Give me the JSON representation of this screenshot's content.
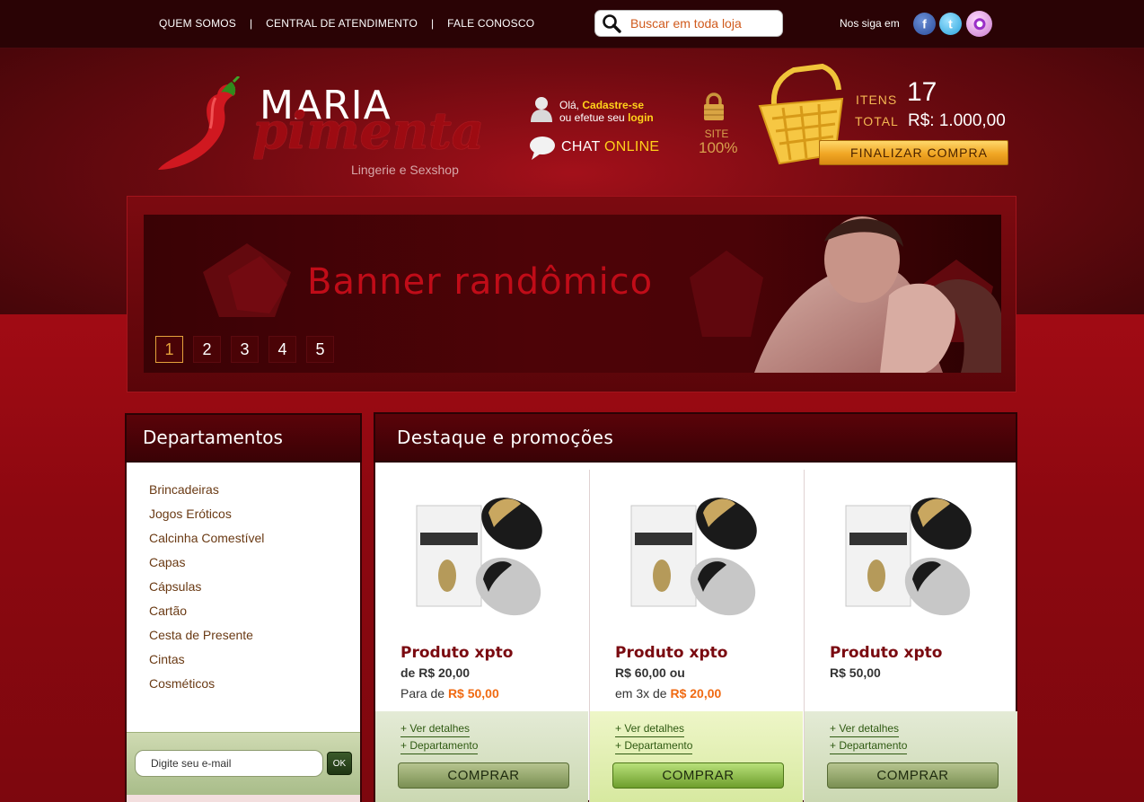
{
  "topbar": {
    "nav": [
      "QUEM SOMOS",
      "CENTRAL DE ATENDIMENTO",
      "FALE CONOSCO"
    ],
    "separator": "|",
    "search_placeholder": "Buscar em toda loja",
    "follow_label": "Nos siga em"
  },
  "header": {
    "logo_line1": "MARIA",
    "logo_line2": "pimenta",
    "logo_tagline": "Lingerie e Sexshop",
    "hello_prefix": "Olá,",
    "signup_link": "Cadastre-se",
    "login_prefix": "ou efetue seu",
    "login_link": "login",
    "chat_label": "CHAT",
    "chat_status": "ONLINE",
    "secure_line1": "SITE",
    "secure_line2": "100%",
    "cart_items_label": "ITENS",
    "cart_items_value": "17",
    "cart_total_label": "TOTAL",
    "cart_total_value": "R$: 1.000,00",
    "checkout_button": "FINALIZAR COMPRA"
  },
  "banner": {
    "title": "Banner randômico",
    "pages": [
      "1",
      "2",
      "3",
      "4",
      "5"
    ],
    "active_page": "1"
  },
  "sidebar": {
    "title": "Departamentos",
    "items": [
      "Brincadeiras",
      "Jogos Eróticos",
      "Calcinha Comestível",
      "Capas",
      "Cápsulas",
      "Cartão",
      "Cesta de Presente",
      "Cintas",
      "Cosméticos"
    ],
    "newsletter_placeholder": "Digite seu e-mail",
    "newsletter_button": "OK"
  },
  "main": {
    "title": "Destaque e promoções",
    "products": [
      {
        "name": "Produto xpto",
        "p1_prefix": "de",
        "p1_value": "R$ 20,00",
        "p2_prefix": "Para de",
        "p2_value": "R$ 50,00",
        "details": "+ Ver detalhes",
        "department": "+ Departamento",
        "buy": "COMPRAR"
      },
      {
        "name": "Produto xpto",
        "p1_prefix": "",
        "p1_value": "R$ 60,00 ou",
        "p2_prefix": "em 3x de",
        "p2_value": "R$ 20,00",
        "details": "+ Ver detalhes",
        "department": "+ Departamento",
        "buy": "COMPRAR"
      },
      {
        "name": "Produto xpto",
        "p1_prefix": "",
        "p1_value": "R$ 50,00",
        "p2_prefix": "",
        "p2_value": "",
        "details": "+ Ver detalhes",
        "department": "+ Departamento",
        "buy": "COMPRAR"
      }
    ]
  }
}
